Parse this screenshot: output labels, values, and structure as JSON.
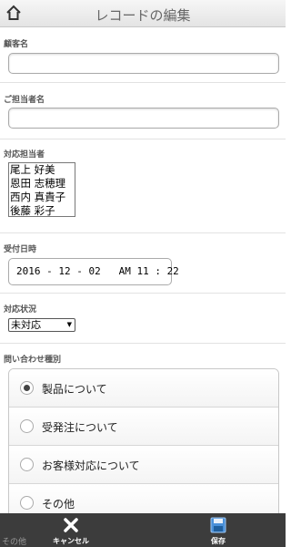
{
  "header": {
    "title": "レコードの編集"
  },
  "customer": {
    "label": "顧客名",
    "value": ""
  },
  "contact": {
    "label": "ご担当者名",
    "value": ""
  },
  "staff": {
    "label": "対応担当者",
    "options": [
      "尾上 好美",
      "恩田 志穂理",
      "西内 真貴子",
      "後藤 彩子"
    ]
  },
  "received": {
    "label": "受付日時",
    "value": "2016 - 12 - 02   AM 11 : 22"
  },
  "status": {
    "label": "対応状況",
    "value": "未対応"
  },
  "inquiry": {
    "label": "問い合わせ種別",
    "options": [
      "製品について",
      "受発注について",
      "お客様対応について",
      "その他"
    ],
    "selected": 0
  },
  "footer": {
    "cancel_label": "キャンセル",
    "save_label": "保存",
    "partial_text": "その他"
  }
}
